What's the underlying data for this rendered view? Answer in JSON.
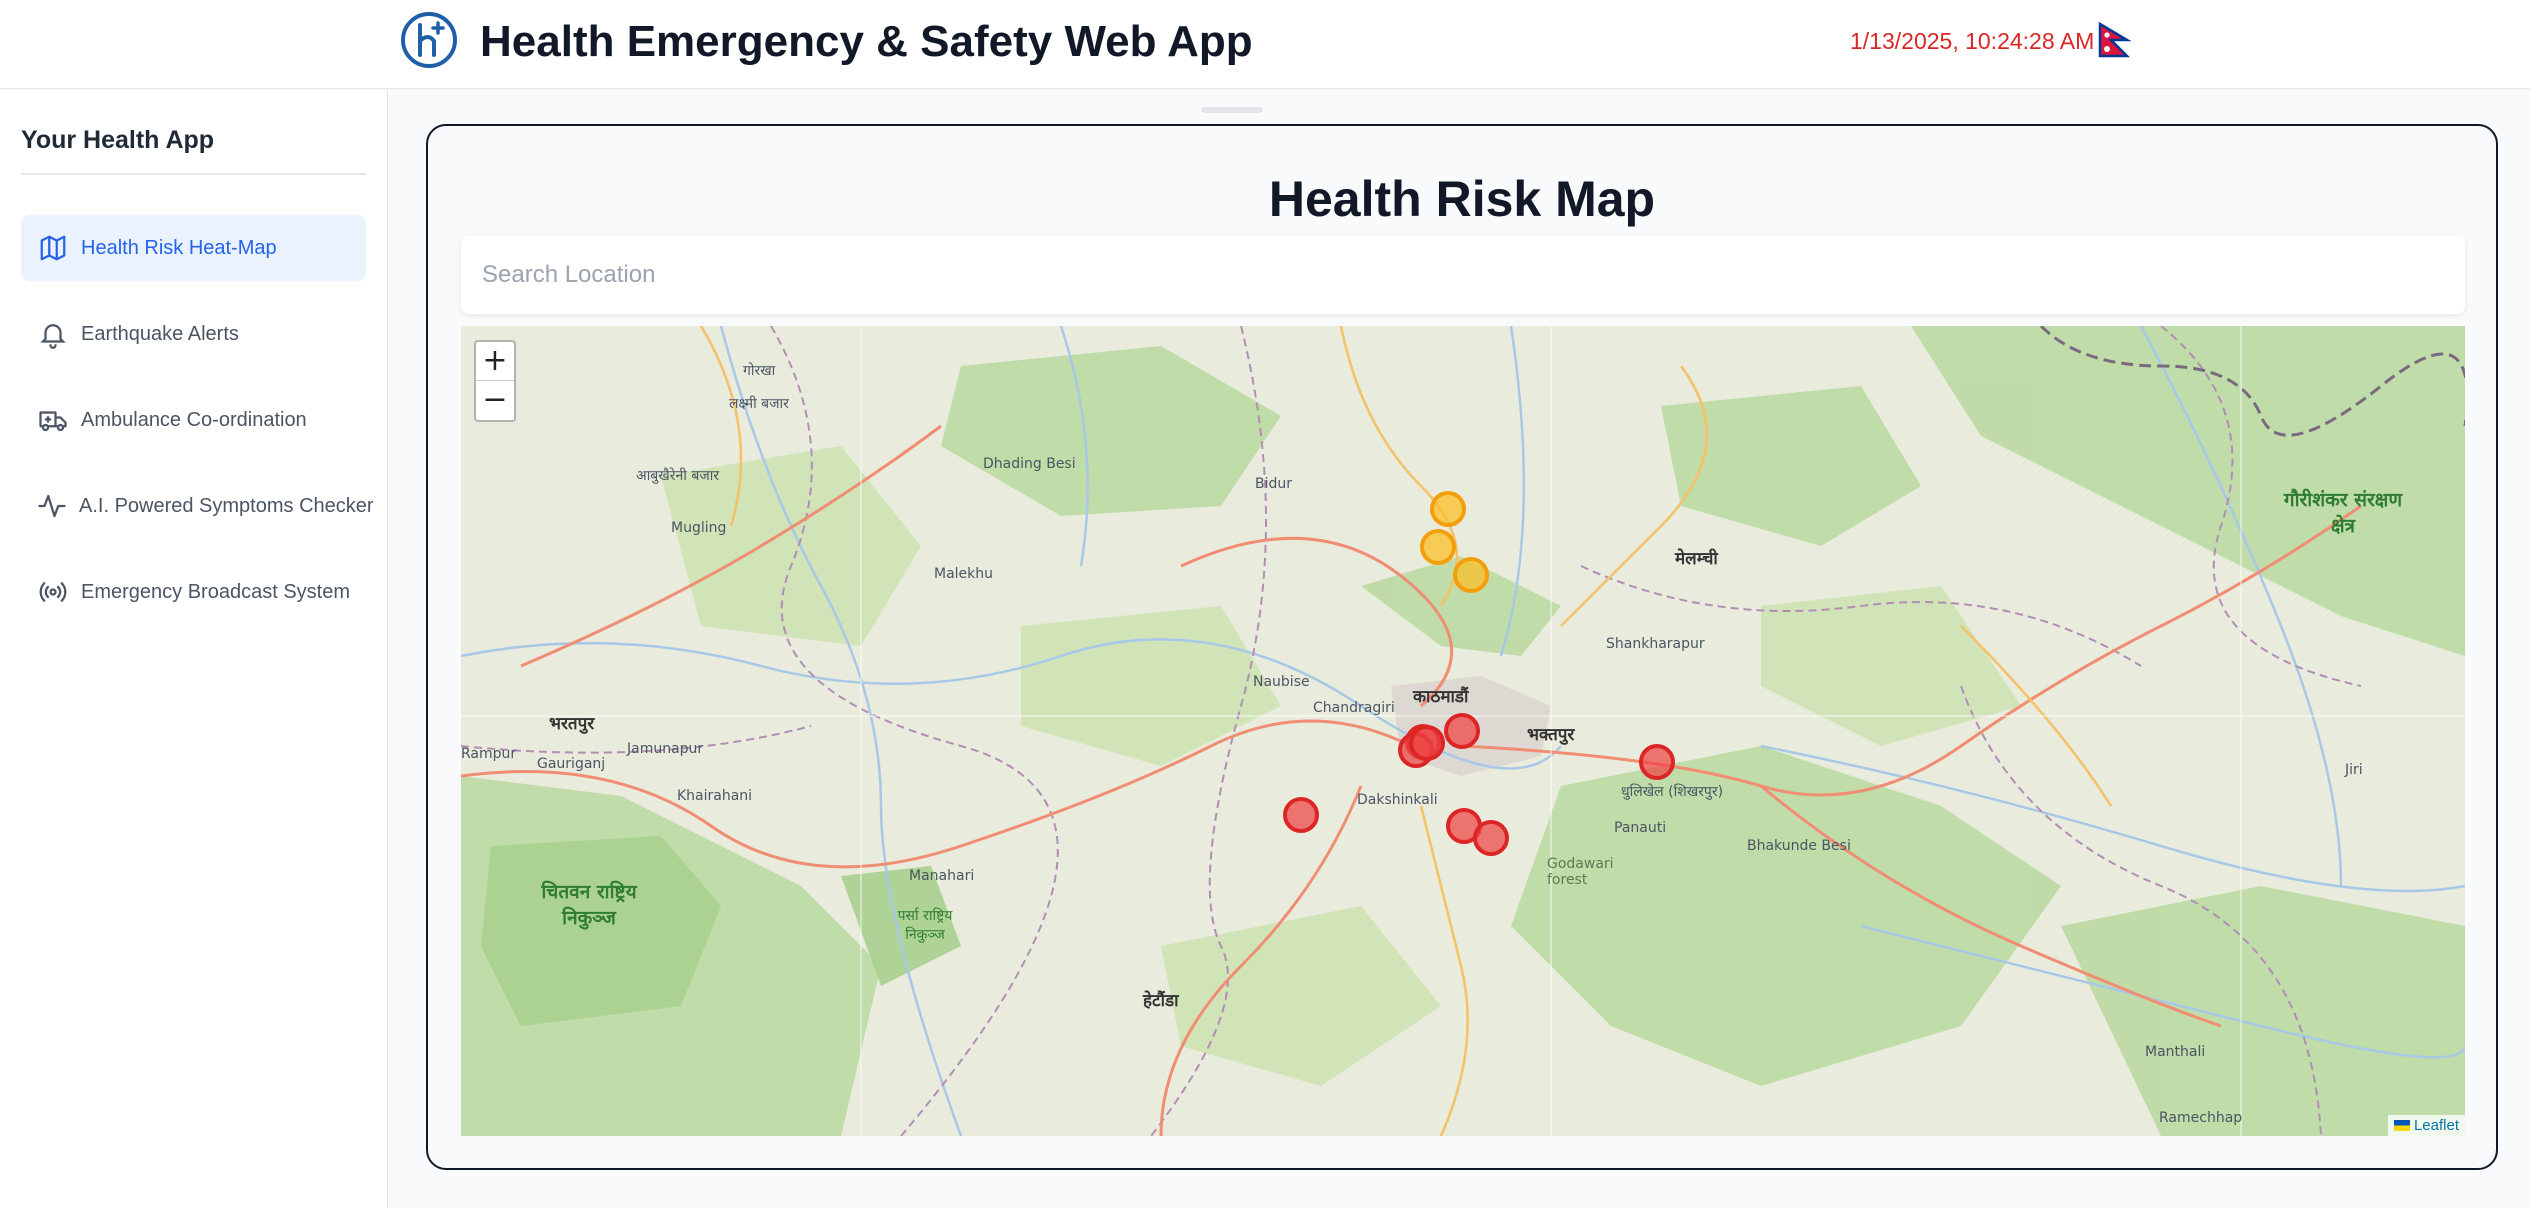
{
  "header": {
    "title": "Health Emergency & Safety Web App",
    "datetime": "1/13/2025, 10:24:28 AM",
    "logo_icon": "health-plus-logo-icon",
    "flag_icon": "nepal-flag-icon"
  },
  "sidebar": {
    "title": "Your Health App",
    "items": [
      {
        "label": "Health Risk Heat-Map",
        "icon": "map-icon",
        "active": true
      },
      {
        "label": "Earthquake Alerts",
        "icon": "bell-icon",
        "active": false
      },
      {
        "label": "Ambulance Co-ordination",
        "icon": "ambulance-icon",
        "active": false
      },
      {
        "label": "A.I. Powered Symptoms Checker",
        "icon": "pulse-icon",
        "active": false
      },
      {
        "label": "Emergency Broadcast System",
        "icon": "broadcast-icon",
        "active": false
      }
    ]
  },
  "main": {
    "title": "Health Risk Map",
    "search_placeholder": "Search Location"
  },
  "map": {
    "zoom_in": "+",
    "zoom_out": "−",
    "attribution": "Leaflet",
    "labels": [
      "गोरखा",
      "लक्ष्मी बजार",
      "आबुखैरेनी बजार",
      "Mugling",
      "Dhading Besi",
      "Bidur",
      "Malekhu",
      "Naubise",
      "Chandragiri",
      "काठमाडौं",
      "भक्तपुर",
      "Dakshinkali",
      "Panauti",
      "Bhakunde Besi",
      "Shankharapur",
      "मेलम्ची",
      "गौरीशंकर संरक्षण क्षेत्र",
      "भरतपुर",
      "Gauriganj",
      "Jamunapur",
      "Khairahani",
      "Rampur",
      "चितवन राष्ट्रिय निकुञ्ज",
      "Manahari",
      "पर्सा राष्ट्रिय निकुञ्ज",
      "हेटौंडा",
      "Manthali",
      "Ramechhap",
      "धुलिखेल (शिखरपुर)",
      "Godawari forest",
      "Jiri"
    ],
    "risk_levels": {
      "red": "#dc2626",
      "orange": "#f59e0b"
    },
    "markers": [
      {
        "level": "orange"
      },
      {
        "level": "orange"
      },
      {
        "level": "orange"
      },
      {
        "level": "red"
      },
      {
        "level": "red"
      },
      {
        "level": "red"
      },
      {
        "level": "red"
      },
      {
        "level": "red"
      },
      {
        "level": "red"
      },
      {
        "level": "red"
      },
      {
        "level": "red"
      }
    ]
  }
}
